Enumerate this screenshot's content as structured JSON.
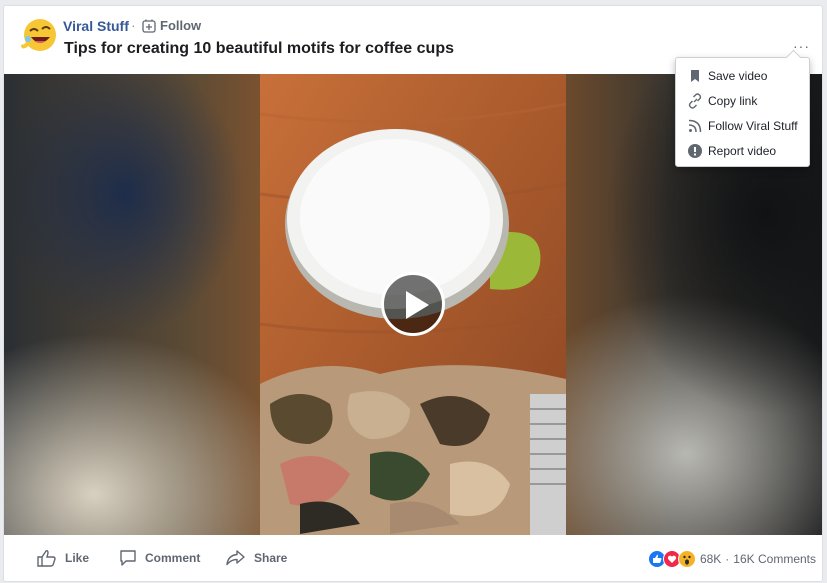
{
  "post": {
    "page_name": "Viral Stuff",
    "separator": "·",
    "follow_label": "Follow",
    "title": "Tips for creating 10 beautiful motifs for coffee cups",
    "more_label": "···"
  },
  "menu": {
    "items": [
      {
        "label": "Save video",
        "icon": "bookmark-icon"
      },
      {
        "label": "Copy link",
        "icon": "link-icon"
      },
      {
        "label": "Follow Viral Stuff",
        "icon": "rss-icon"
      },
      {
        "label": "Report video",
        "icon": "exclamation-icon"
      }
    ]
  },
  "footer": {
    "like_label": "Like",
    "comment_label": "Comment",
    "share_label": "Share",
    "reaction_count": "68K",
    "reaction_separator": "·",
    "comments_count": "16K Comments"
  },
  "colors": {
    "link_blue": "#365899",
    "like_blue": "#1877f2",
    "love_red": "#f0284a",
    "wow_yellow": "#f7b125"
  }
}
